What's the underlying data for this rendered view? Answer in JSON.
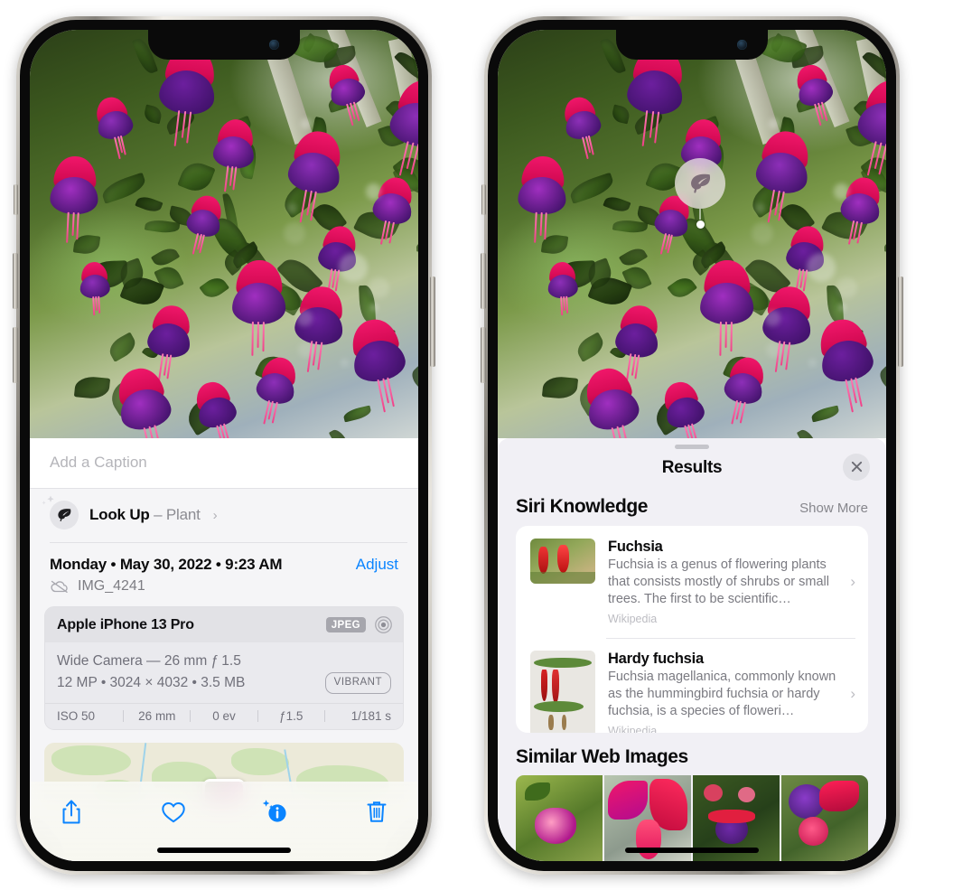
{
  "left_phone": {
    "caption": {
      "placeholder": "Add a Caption",
      "value": ""
    },
    "lookup": {
      "label": "Look Up",
      "dash": " – ",
      "subject": "Plant",
      "chevron": "›",
      "icon": "leaf-icon"
    },
    "meta": {
      "date": "Monday • May 30, 2022 • 9:23 AM",
      "adjust": "Adjust",
      "filename": "IMG_4241",
      "cloud_icon": "cloud-slash-icon"
    },
    "camera": {
      "device": "Apple iPhone 13 Pro",
      "format_badge": "JPEG",
      "lens_icon": "aperture-icon",
      "lens_line": "Wide Camera — 26 mm ƒ 1.5",
      "specs_line": "12 MP • 3024 × 4032 • 3.5 MB",
      "style_badge": "VIBRANT",
      "exif": [
        "ISO 50",
        "26 mm",
        "0 ev",
        "ƒ1.5",
        "1/181 s"
      ]
    },
    "toolbar": [
      {
        "name": "share-button",
        "icon": "share-icon"
      },
      {
        "name": "favorite-button",
        "icon": "heart-icon"
      },
      {
        "name": "info-button",
        "icon": "info-sparkle-icon"
      },
      {
        "name": "delete-button",
        "icon": "trash-icon"
      }
    ],
    "map": {
      "pin": "photo-pin"
    }
  },
  "right_phone": {
    "annotation": {
      "icon": "leaf-icon"
    },
    "sheet": {
      "title": "Results",
      "close_icon": "close-icon",
      "grabber": "drag-handle"
    },
    "siri_knowledge": {
      "heading": "Siri Knowledge",
      "show_more": "Show More",
      "items": [
        {
          "title": "Fuchsia",
          "description": "Fuchsia is a genus of flowering plants that consists mostly of shrubs or small trees. The first to be scientific…",
          "source": "Wikipedia",
          "chevron": "›"
        },
        {
          "title": "Hardy fuchsia",
          "description": "Fuchsia magellanica, commonly known as the hummingbird fuchsia or hardy fuchsia, is a species of floweri…",
          "source": "Wikipedia",
          "chevron": "›"
        }
      ]
    },
    "similar_web_images": {
      "heading": "Similar Web Images",
      "tiles": [
        "web-image-1",
        "web-image-2",
        "web-image-3",
        "web-image-4"
      ]
    }
  },
  "colors": {
    "accent_blue": "#0a84ff",
    "sheet_bg": "#f1f0f5",
    "card_bg": "#ffffff",
    "panel_bg": "#f5f5f7",
    "secondary_text": "#7a7a81"
  }
}
